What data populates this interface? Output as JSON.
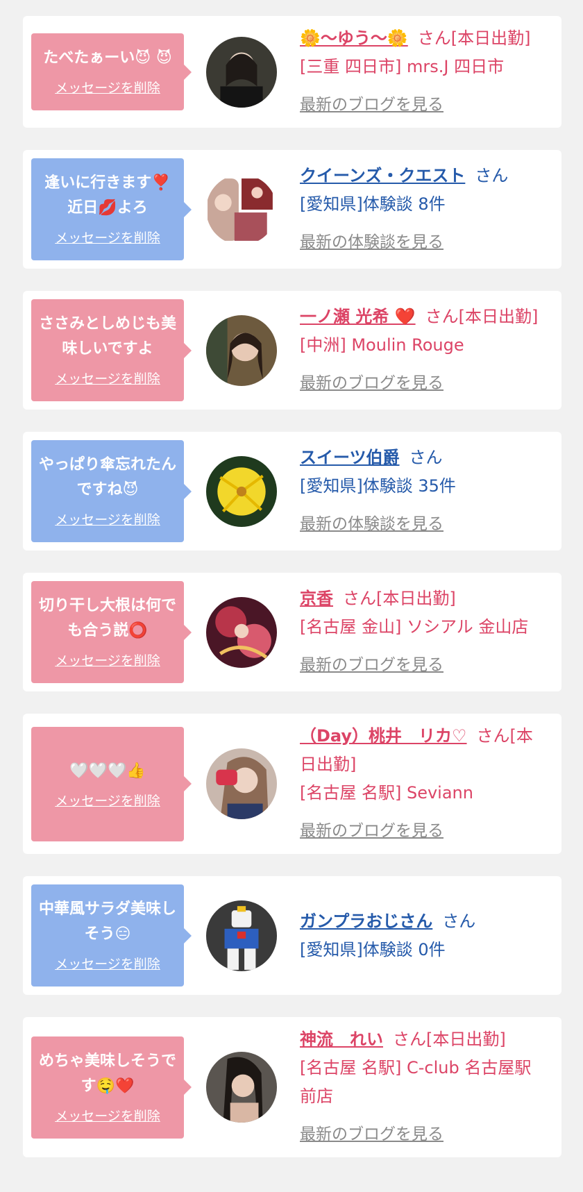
{
  "delete_label": "メッセージを削除",
  "cards": [
    {
      "theme": "pink",
      "message": "たべたぁーい😈 😈",
      "name": "🌼〜ゆう〜🌼",
      "suffix": "さん[本日出勤]",
      "detail": "[三重 四日市] mrs.J 四日市",
      "link": "最新のブログを見る"
    },
    {
      "theme": "blue",
      "message": "逢いに行きます❣️ 近日💋よろ",
      "name": "クイーンズ・クエスト",
      "suffix": "さん",
      "detail": "[愛知県]体験談 8件",
      "link": "最新の体験談を見る"
    },
    {
      "theme": "pink",
      "message": "ささみとしめじも美味しいですよ",
      "name": "一ノ瀬 光希 ❤️",
      "suffix": "さん[本日出勤]",
      "detail": "[中洲] Moulin Rouge",
      "link": "最新のブログを見る"
    },
    {
      "theme": "blue",
      "message": "やっぱり傘忘れたんですね😈",
      "name": "スイーツ伯爵",
      "suffix": "さん",
      "detail": "[愛知県]体験談 35件",
      "link": "最新の体験談を見る"
    },
    {
      "theme": "pink",
      "message": "切り干し大根は何でも合う説⭕",
      "name": "京香",
      "suffix": "さん[本日出勤]",
      "detail": "[名古屋 金山] ソシアル 金山店",
      "link": "最新のブログを見る"
    },
    {
      "theme": "pink",
      "message": "🤍🤍🤍👍",
      "name": "（Day）桃井　リカ♡",
      "suffix": "さん[本日出勤]",
      "detail": "[名古屋 名駅] Seviann",
      "link": "最新のブログを見る"
    },
    {
      "theme": "blue",
      "message": "中華風サラダ美味しそう😑",
      "name": "ガンプラおじさん",
      "suffix": "さん",
      "detail": "[愛知県]体験談 0件",
      "link": "最新の体験談を見る"
    },
    {
      "theme": "pink",
      "message": "めちゃ美味しそうです🤤❤️",
      "name": "神流　れい",
      "suffix": "さん[本日出勤]",
      "detail": "[名古屋 名駅] C-club 名古屋駅前店",
      "link": "最新のブログを見る"
    }
  ]
}
